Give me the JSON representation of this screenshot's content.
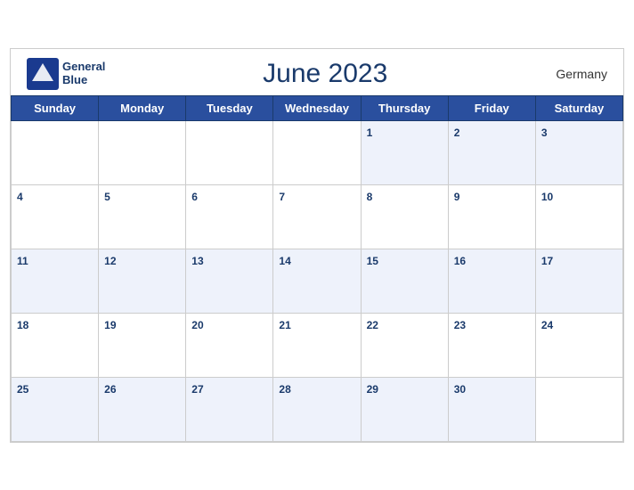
{
  "header": {
    "title": "June 2023",
    "country": "Germany",
    "logo_line1": "General",
    "logo_line2": "Blue"
  },
  "weekdays": [
    "Sunday",
    "Monday",
    "Tuesday",
    "Wednesday",
    "Thursday",
    "Friday",
    "Saturday"
  ],
  "weeks": [
    [
      null,
      null,
      null,
      null,
      1,
      2,
      3
    ],
    [
      4,
      5,
      6,
      7,
      8,
      9,
      10
    ],
    [
      11,
      12,
      13,
      14,
      15,
      16,
      17
    ],
    [
      18,
      19,
      20,
      21,
      22,
      23,
      24
    ],
    [
      25,
      26,
      27,
      28,
      29,
      30,
      null
    ]
  ]
}
